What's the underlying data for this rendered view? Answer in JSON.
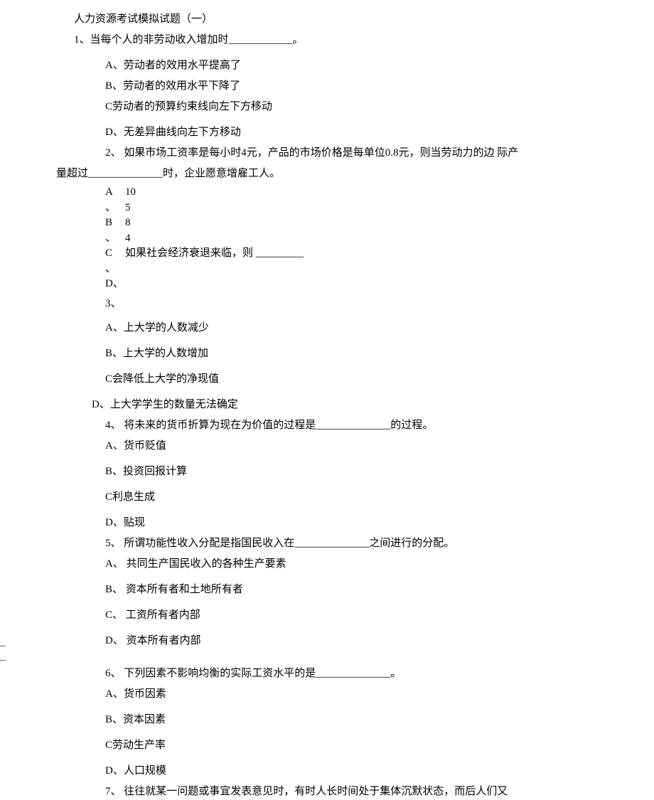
{
  "title": "人力资源考试模拟试题（一）",
  "q1": {
    "stem": "1、当每个人的非劳动收入增加时____________。",
    "a": "A、劳动者的效用水平提高了",
    "b": "B、劳动者的效用水平下降了",
    "c": "C劳动者的预算约束线向左下方移动",
    "d": "D、无差异曲线向左下方移动"
  },
  "q2": {
    "stem_part1": "2、 如果市场工资率是每小时4元，产品的市场价格是每单位0.8元，则当劳动力的边  际产",
    "stem_part2": "量超过______________时，企业愿意增雇工人。",
    "col_left": [
      "A",
      "、",
      "B",
      "、",
      "C",
      "、",
      "D、",
      "3、"
    ],
    "col_right": [
      "10",
      "5",
      "8",
      "4",
      "如果社会经济衰退来临，则   _________"
    ],
    "a": "A、上大学的人数减少",
    "b": "B、上大学的人数增加",
    "c": "C会降低上大学的净现值",
    "d": "D、上大学学生的数量无法确定"
  },
  "q4": {
    "stem": "4、 将未来的货币折算为现在为价值的过程是______________的过程。",
    "a": "A、货币贬值",
    "b": "B、投资回报计算",
    "c": "C利息生成",
    "d": "D、贴现"
  },
  "q5": {
    "stem": "5、 所谓功能性收入分配是指国民收入在______________之间进行的分配。",
    "a": "A、   共同生产国民收入的各种生产要素",
    "b": "B、   资本所有者和土地所有者",
    "c": "C、   工资所有者内部",
    "d": "D、   资本所有者内部"
  },
  "q6": {
    "stem": "6、 下列因素不影响均衡的实际工资水平的是______________。",
    "a": "A、货币因素",
    "b": "B、资本因素",
    "c": "C劳动生产率",
    "d": "D、人口规模"
  },
  "q7": {
    "stem": "7、 往往就某一问题或事宜发表意见时，有时人长时间处于集体沉默状态，而后人们又"
  }
}
